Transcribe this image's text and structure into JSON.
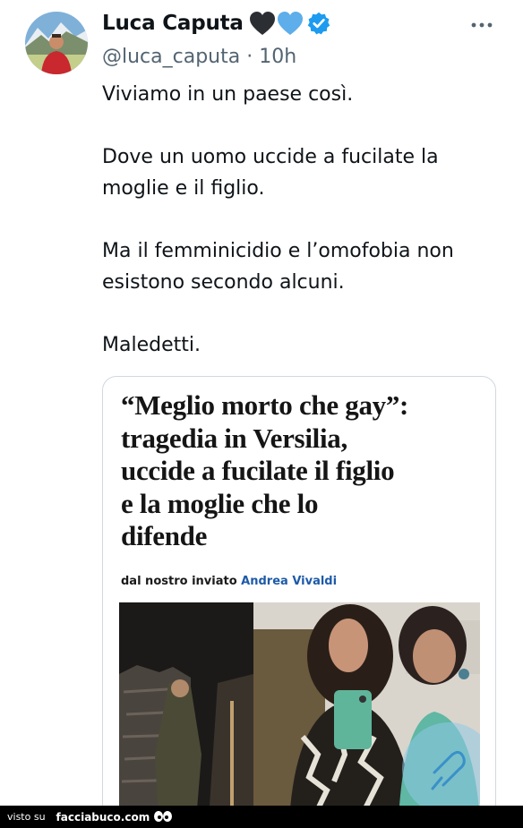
{
  "tweet": {
    "author_name": "Luca Caputa",
    "handle": "@luca_caputa",
    "time": "· 10h",
    "paragraphs": [
      [
        "Viviamo in un paese così."
      ],
      [
        "Dove un uomo uccide a fucilate la",
        "moglie e il figlio."
      ],
      [
        "Ma il femminicidio e l’omofobia non",
        "esistono secondo alcuni."
      ],
      [
        "Maledetti."
      ]
    ],
    "icons": [
      "black-heart-icon",
      "blue-heart-icon",
      "verified-badge-icon",
      "more-options-icon"
    ]
  },
  "card": {
    "headline_lines": [
      "“Meglio morto che gay”:",
      "tragedia in Versilia,",
      "uccide a fucilate il figlio",
      "e la moglie che lo",
      "difende"
    ],
    "byline_prefix": "dal nostro inviato",
    "byline_author": "Andrea Vivaldi"
  },
  "footer": {
    "prefix": "visto su",
    "site": "facciabuco.com"
  },
  "colors": {
    "text": "#0f1419",
    "secondary": "#536471",
    "verified": "#1d9bf0",
    "byline_author": "#1d5aa8"
  }
}
